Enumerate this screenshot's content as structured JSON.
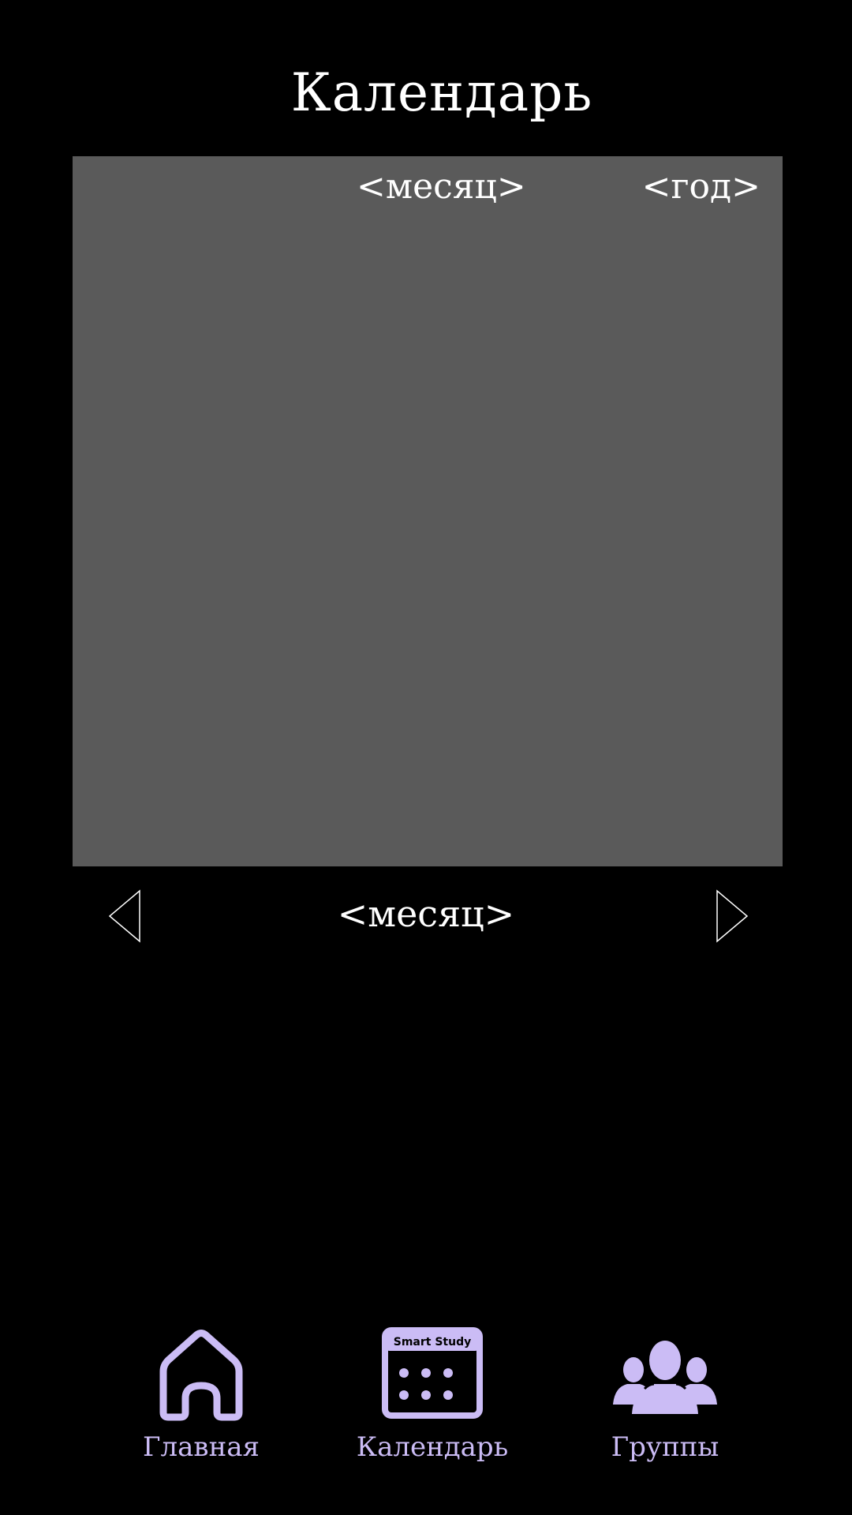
{
  "header": {
    "title": "Календарь"
  },
  "calendar_panel": {
    "month_label": "<месяц>",
    "year_label": "<год>"
  },
  "month_navigation": {
    "prev_icon": "triangle-left-outline-icon",
    "next_icon": "triangle-right-outline-icon",
    "month_label": "<месяц>"
  },
  "bottom_nav": {
    "items": [
      {
        "icon": "home-icon",
        "label": "Главная"
      },
      {
        "icon": "calendar-icon",
        "label": "Календарь",
        "icon_caption": "Smart Study"
      },
      {
        "icon": "users-icon",
        "label": "Группы"
      }
    ]
  },
  "colors": {
    "background": "#000000",
    "panel": "#5a5a5a",
    "text": "#ffffff",
    "accent": "#cbbcf5"
  }
}
